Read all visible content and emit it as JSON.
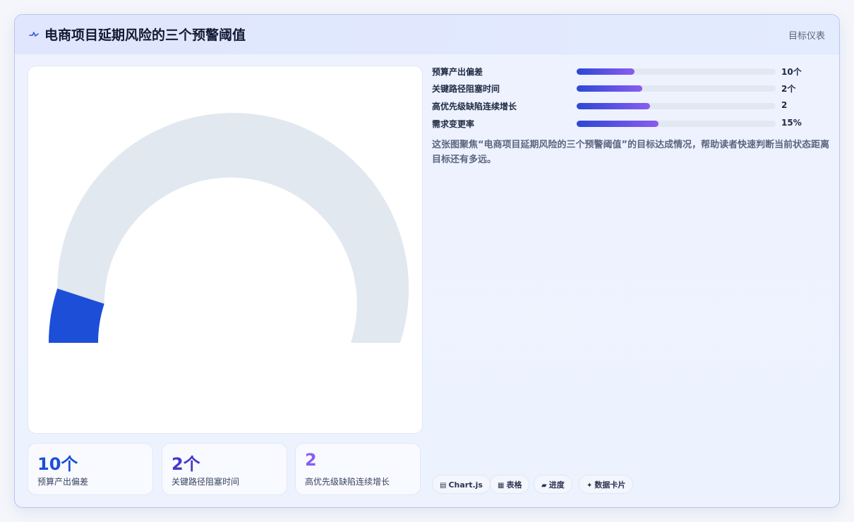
{
  "header": {
    "title": "电商项目延期风险的三个预警阈值",
    "tag": "目标仪表"
  },
  "colors": {
    "gauge_fill": "#1d4ed8",
    "gauge_track": "#e2e8f0",
    "bar_start": "#2c47d6",
    "bar_end": "#8a5cf0"
  },
  "chart_data": {
    "type": "gauge",
    "gauge": {
      "value": 10,
      "max": 100
    },
    "metrics": [
      {
        "label": "预算产出偏差",
        "value_text": "10个",
        "progress": 0.29
      },
      {
        "label": "关键路径阻塞时间",
        "value_text": "2个",
        "progress": 0.33
      },
      {
        "label": "高优先级缺陷连续增长",
        "value_text": "2",
        "progress": 0.37
      },
      {
        "label": "需求变更率",
        "value_text": "15%",
        "progress": 0.41
      }
    ]
  },
  "stats": [
    {
      "value": "10个",
      "label": "预算产出偏差",
      "color": "#1d4ed8"
    },
    {
      "value": "2个",
      "label": "关键路径阻塞时间",
      "color": "#4338ca"
    },
    {
      "value": "2",
      "label": "高优先级缺陷连续增长",
      "color": "#8b5cf6"
    }
  ],
  "description": "这张图聚焦“电商项目延期风险的三个预警阈值”的目标达成情况，帮助读者快速判断当前状态距离目标还有多远。",
  "chips": [
    {
      "icon": "chart-icon",
      "glyph": "▤",
      "label": "Chart.js"
    },
    {
      "icon": "table-icon",
      "glyph": "▦",
      "label": "表格"
    },
    {
      "icon": "progress-icon",
      "glyph": "▰",
      "label": "进度"
    },
    {
      "icon": "sparkle-icon",
      "glyph": "✦",
      "label": "数据卡片"
    }
  ]
}
